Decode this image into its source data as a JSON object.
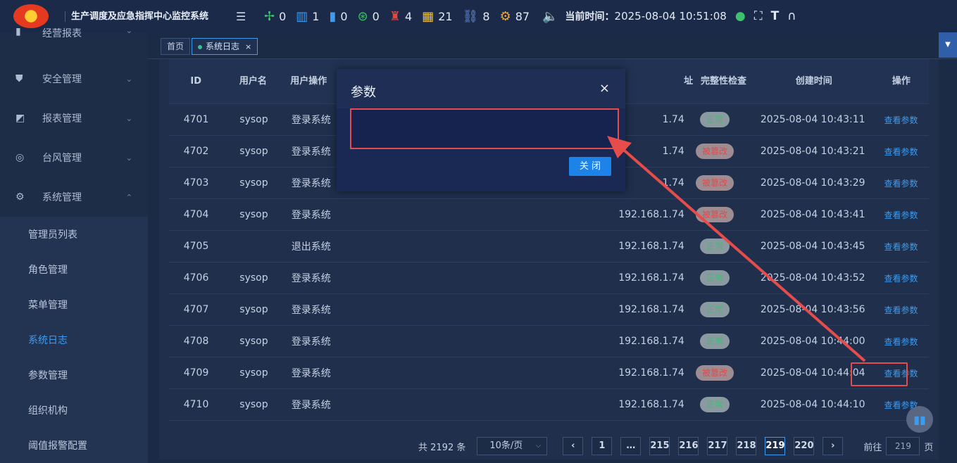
{
  "header": {
    "title": "生产调度及应急指挥中心监控系统",
    "stats": [
      {
        "icon": "wind-turbine-icon",
        "glyph": "✢",
        "value": "0",
        "color": "#3cc26a"
      },
      {
        "icon": "device-icon",
        "glyph": "▥",
        "value": "1",
        "color": "#3d9cf0"
      },
      {
        "icon": "battery-icon",
        "glyph": "▮",
        "value": "0",
        "color": "#3d9cf0"
      },
      {
        "icon": "motor-icon",
        "glyph": "⊛",
        "value": "0",
        "color": "#3cc26a"
      },
      {
        "icon": "fire-extinguisher-icon",
        "glyph": "♜",
        "value": "4",
        "color": "#e0473c"
      },
      {
        "icon": "solar-panel-icon",
        "glyph": "▦",
        "value": "21",
        "color": "#f0c23a"
      },
      {
        "icon": "chain-icon",
        "glyph": "⛓",
        "value": "8",
        "color": "#6a8fd8"
      },
      {
        "icon": "gears-icon",
        "glyph": "⚙",
        "value": "87",
        "color": "#f0a53a"
      }
    ],
    "time_label": "当前时间：",
    "time_value": "2025-08-04 10:51:08"
  },
  "sidebar": {
    "menus": [
      {
        "label": "经营报表",
        "icon": "bar-chart-icon",
        "glyph": "▮"
      },
      {
        "label": "安全管理",
        "icon": "shield-icon",
        "glyph": "⛊"
      },
      {
        "label": "报表管理",
        "icon": "report-icon",
        "glyph": "◩"
      },
      {
        "label": "台风管理",
        "icon": "typhoon-icon",
        "glyph": "◎"
      },
      {
        "label": "系统管理",
        "icon": "settings-icon",
        "glyph": "⚙"
      }
    ],
    "subs": [
      "管理员列表",
      "角色管理",
      "菜单管理",
      "系统日志",
      "参数管理",
      "组织机构",
      "阈值报警配置"
    ]
  },
  "tabs": {
    "home": "首页",
    "current": "系统日志",
    "close": "×"
  },
  "table": {
    "headers": [
      "ID",
      "用户名",
      "用户操作",
      "址",
      "完整性检查",
      "创建时间",
      "操作"
    ],
    "rows": [
      {
        "id": "4701",
        "user": "sysop",
        "op": "登录系统",
        "ip": "1.74",
        "status": "正常",
        "time": "2025-08-04 10:43:11",
        "action": "查看参数"
      },
      {
        "id": "4702",
        "user": "sysop",
        "op": "登录系统",
        "ip": "1.74",
        "status": "被篡改",
        "time": "2025-08-04 10:43:21",
        "action": "查看参数"
      },
      {
        "id": "4703",
        "user": "sysop",
        "op": "登录系统",
        "ip": "1.74",
        "status": "被篡改",
        "time": "2025-08-04 10:43:29",
        "action": "查看参数"
      },
      {
        "id": "4704",
        "user": "sysop",
        "op": "登录系统",
        "ip": "192.168.1.74",
        "status": "被篡改",
        "time": "2025-08-04 10:43:41",
        "action": "查看参数"
      },
      {
        "id": "4705",
        "user": "",
        "op": "退出系统",
        "ip": "192.168.1.74",
        "status": "正常",
        "time": "2025-08-04 10:43:45",
        "action": "查看参数"
      },
      {
        "id": "4706",
        "user": "sysop",
        "op": "登录系统",
        "ip": "192.168.1.74",
        "status": "正常",
        "time": "2025-08-04 10:43:52",
        "action": "查看参数"
      },
      {
        "id": "4707",
        "user": "sysop",
        "op": "登录系统",
        "ip": "192.168.1.74",
        "status": "正常",
        "time": "2025-08-04 10:43:56",
        "action": "查看参数"
      },
      {
        "id": "4708",
        "user": "sysop",
        "op": "登录系统",
        "ip": "192.168.1.74",
        "status": "正常",
        "time": "2025-08-04 10:44:00",
        "action": "查看参数"
      },
      {
        "id": "4709",
        "user": "sysop",
        "op": "登录系统",
        "ip": "192.168.1.74",
        "status": "被篡改",
        "time": "2025-08-04 10:44:04",
        "action": "查看参数"
      },
      {
        "id": "4710",
        "user": "sysop",
        "op": "登录系统",
        "ip": "192.168.1.74",
        "status": "正常",
        "time": "2025-08-04 10:44:10",
        "action": "查看参数"
      }
    ]
  },
  "pager": {
    "total": "共 2192 条",
    "page_size": "10条/页",
    "pages": [
      "1",
      "…",
      "215",
      "216",
      "217",
      "218",
      "219",
      "220"
    ],
    "current": "219",
    "goto_label": "前往",
    "goto_value": "219",
    "page_suffix": "页"
  },
  "modal": {
    "title": "参数",
    "close": "×",
    "button": "关 闭"
  },
  "colors": {
    "accent": "#3d9cf0",
    "ok": "#43bb76",
    "bad": "#dd4b4b",
    "annotation": "#e74c4c"
  }
}
